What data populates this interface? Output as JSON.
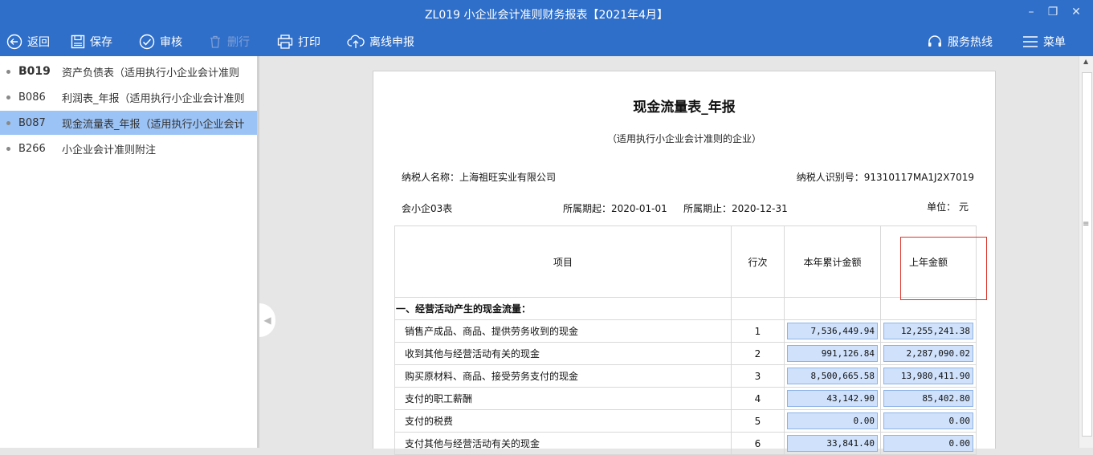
{
  "window": {
    "title": "ZL019 小企业会计准则财务报表【2021年4月】"
  },
  "toolbar": {
    "back": "返回",
    "save": "保存",
    "audit": "审核",
    "delete_row": "删行",
    "print": "打印",
    "offline": "离线申报",
    "hotline": "服务热线",
    "menu": "菜单"
  },
  "sidebar": {
    "items": [
      {
        "code": "B019",
        "label": "资产负债表（适用执行小企业会计准则"
      },
      {
        "code": "B086",
        "label": "利润表_年报（适用执行小企业会计准则"
      },
      {
        "code": "B087",
        "label": "现金流量表_年报（适用执行小企业会计"
      },
      {
        "code": "B266",
        "label": "小企业会计准则附注"
      }
    ]
  },
  "report": {
    "title": "现金流量表_年报",
    "subtitle": "（适用执行小企业会计准则的企业）",
    "taxpayer_name_label": "纳税人名称：",
    "taxpayer_name": "上海祖旺实业有限公司",
    "taxpayer_id_label": "纳税人识别号：",
    "taxpayer_id": "91310117MA1J2X7019",
    "form_code": "会小企03表",
    "period_start_label": "所属期起：",
    "period_start": "2020-01-01",
    "period_end_label": "所属期止：",
    "period_end": "2020-12-31",
    "unit_label": "单位：",
    "unit": "元",
    "columns": {
      "item": "项目",
      "line": "行次",
      "current": "本年累计金额",
      "prior": "上年金额"
    },
    "section": "一、经营活动产生的现金流量：",
    "rows": [
      {
        "item": "销售产成品、商品、提供劳务收到的现金",
        "line": "1",
        "current": "7,536,449.94",
        "prior": "12,255,241.38"
      },
      {
        "item": "收到其他与经营活动有关的现金",
        "line": "2",
        "current": "991,126.84",
        "prior": "2,287,090.02"
      },
      {
        "item": "购买原材料、商品、接受劳务支付的现金",
        "line": "3",
        "current": "8,500,665.58",
        "prior": "13,980,411.90"
      },
      {
        "item": "支付的职工薪酬",
        "line": "4",
        "current": "43,142.90",
        "prior": "85,402.80"
      },
      {
        "item": "支付的税费",
        "line": "5",
        "current": "0.00",
        "prior": "0.00"
      },
      {
        "item": "支付其他与经营活动有关的现金",
        "line": "6",
        "current": "33,841.40",
        "prior": "0.00"
      }
    ]
  }
}
